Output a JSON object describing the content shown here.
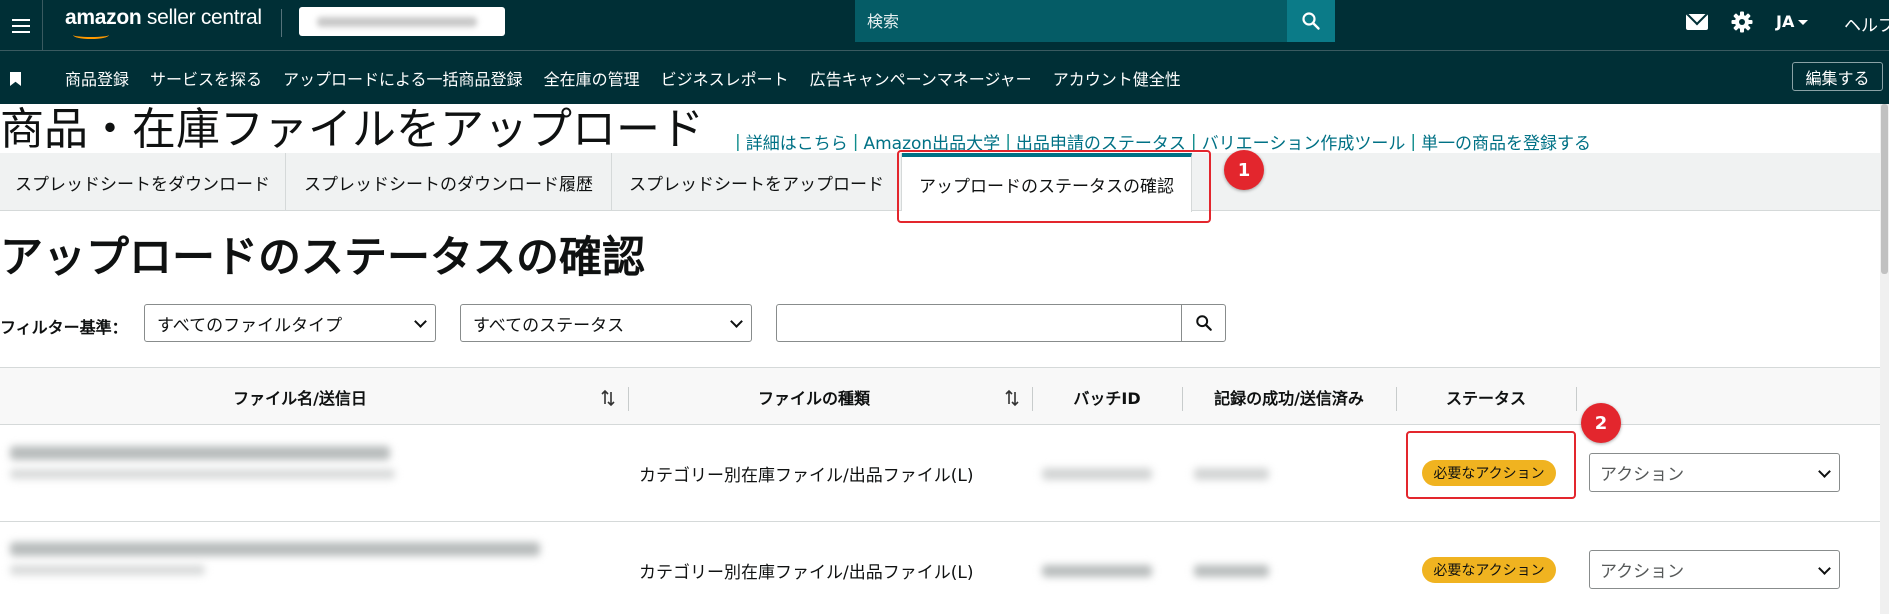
{
  "header": {
    "logo_bold": "amazon",
    "logo_light": " seller central",
    "search_placeholder": "検索",
    "language": "JA",
    "help": "ヘルプ"
  },
  "nav": {
    "items": [
      {
        "label": "商品登録"
      },
      {
        "label": "サービスを探る"
      },
      {
        "label": "アップロードによる一括商品登録"
      },
      {
        "label": "全在庫の管理"
      },
      {
        "label": "ビジネスレポート"
      },
      {
        "label": "広告キャンペーンマネージャー"
      },
      {
        "label": "アカウント健全性"
      }
    ],
    "edit_label": "編集する"
  },
  "page": {
    "title": "商品・在庫ファイルをアップロード",
    "links": [
      {
        "label": "詳細はこちら"
      },
      {
        "label": "Amazon出品大学"
      },
      {
        "label": "出品申請のステータス"
      },
      {
        "label": "バリエーション作成ツール"
      },
      {
        "label": "単一の商品を登録する"
      }
    ]
  },
  "tabs": [
    {
      "label": "スプレッドシートをダウンロード"
    },
    {
      "label": "スプレッドシートのダウンロード履歴"
    },
    {
      "label": "スプレッドシートをアップロード"
    },
    {
      "label": "アップロードのステータスの確認",
      "active": true
    }
  ],
  "annotations": {
    "badge_1": "1",
    "badge_2": "2",
    "highlight_color": "#e3262d"
  },
  "section": {
    "title": "アップロードのステータスの確認",
    "filter_label": "フィルター基準：",
    "file_type_select": "すべてのファイルタイプ",
    "status_select": "すべてのステータス",
    "search_value": ""
  },
  "table": {
    "columns": [
      "ファイル名/送信日",
      "ファイルの種類",
      "バッチID",
      "記録の成功/送信済み",
      "ステータス"
    ],
    "rows": [
      {
        "file_type": "カテゴリー別在庫ファイル/出品ファイル(L)",
        "status": "必要なアクション",
        "action": "アクション"
      },
      {
        "file_type": "カテゴリー別在庫ファイル/出品ファイル(L)",
        "status": "必要なアクション",
        "action": "アクション"
      }
    ]
  },
  "colors": {
    "topbar": "#002f36",
    "search_bg": "#055c66",
    "search_btn": "#0b7b88",
    "link": "#007185",
    "status_pill": "#f0b320"
  }
}
